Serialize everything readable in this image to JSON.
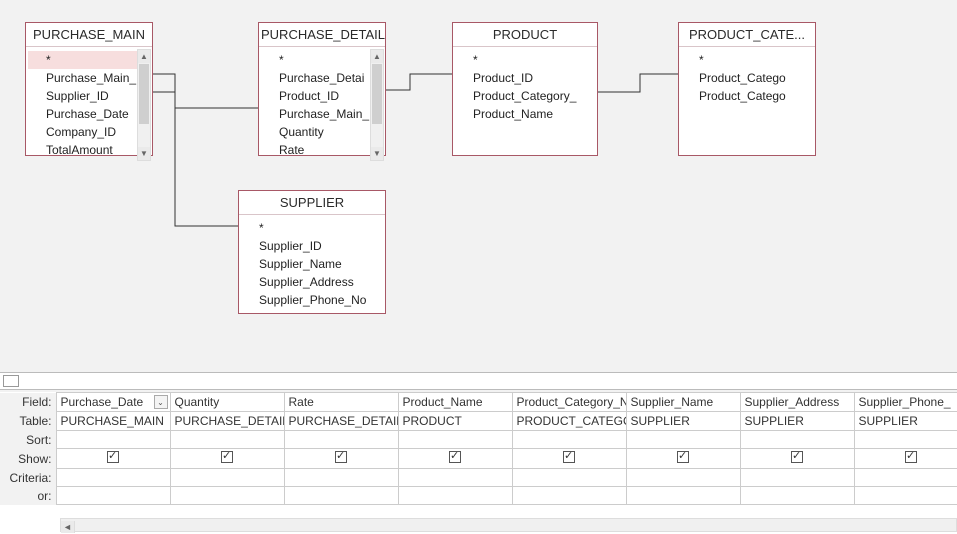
{
  "tables": {
    "purchase_main": {
      "title": "PURCHASE_MAIN",
      "fields": [
        "*",
        "Purchase_Main_",
        "Supplier_ID",
        "Purchase_Date",
        "Company_ID",
        "TotalAmount"
      ],
      "selected_index": 0,
      "has_scroll": true
    },
    "purchase_detail": {
      "title": "PURCHASE_DETAIL",
      "fields": [
        "*",
        "Purchase_Detai",
        "Product_ID",
        "Purchase_Main_",
        "Quantity",
        "Rate"
      ],
      "has_scroll": true
    },
    "product": {
      "title": "PRODUCT",
      "fields": [
        "*",
        "Product_ID",
        "Product_Category_",
        "Product_Name"
      ],
      "has_scroll": false
    },
    "product_category": {
      "title": "PRODUCT_CATE...",
      "fields": [
        "*",
        "Product_Catego",
        "Product_Catego"
      ],
      "has_scroll": false
    },
    "supplier": {
      "title": "SUPPLIER",
      "fields": [
        "*",
        "Supplier_ID",
        "Supplier_Name",
        "Supplier_Address",
        "Supplier_Phone_No"
      ],
      "has_scroll": false
    }
  },
  "grid": {
    "row_labels": {
      "field": "Field:",
      "table": "Table:",
      "sort": "Sort:",
      "show": "Show:",
      "criteria": "Criteria:",
      "or": "or:"
    },
    "columns": [
      {
        "field": "Purchase_Date",
        "table": "PURCHASE_MAIN",
        "show": true,
        "dropdown": true
      },
      {
        "field": "Quantity",
        "table": "PURCHASE_DETAIL",
        "show": true
      },
      {
        "field": "Rate",
        "table": "PURCHASE_DETAIL",
        "show": true
      },
      {
        "field": "Product_Name",
        "table": "PRODUCT",
        "show": true
      },
      {
        "field": "Product_Category_Na",
        "table": "PRODUCT_CATEGORY",
        "show": true
      },
      {
        "field": "Supplier_Name",
        "table": "SUPPLIER",
        "show": true
      },
      {
        "field": "Supplier_Address",
        "table": "SUPPLIER",
        "show": true
      },
      {
        "field": "Supplier_Phone_",
        "table": "SUPPLIER",
        "show": true
      }
    ]
  }
}
